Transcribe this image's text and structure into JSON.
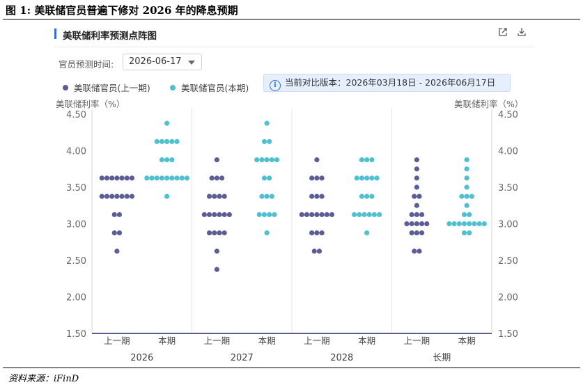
{
  "figure": {
    "title": "图 1:  美联储官员普遍下修对 2026 年的降息预期",
    "source": "资料来源：iFinD"
  },
  "panel": {
    "title": "美联储利率预测点阵图",
    "export_icon": "external-link-icon",
    "download_icon": "download-icon"
  },
  "controls": {
    "date_label": "官员预测时间:",
    "date_value": "2026-06-17"
  },
  "legend": {
    "previous": "美联储官员(上一期)",
    "current": "美联储官员(本期)",
    "compare_text": "当前对比版本：2026年03月18日 - 2026年06月17日"
  },
  "colors": {
    "previous": "#5b5e96",
    "current": "#4fc0cf",
    "axis": "#5b5e96"
  },
  "chart_data": {
    "type": "scatter",
    "subtype": "dot-plot",
    "ylabel": "美联储利率（%）",
    "ylabel_right": "美联储利率（%）",
    "ylim": [
      1.5,
      4.5
    ],
    "yticks": [
      "1.50",
      "2.00",
      "2.50",
      "3.00",
      "3.50",
      "4.00",
      "4.50"
    ],
    "groups": [
      "2026",
      "2027",
      "2028",
      "长期"
    ],
    "sub_labels": [
      "上一期",
      "本期"
    ],
    "grid": "vertical group separators",
    "data": [
      {
        "group": "2026",
        "previous": [
          {
            "y": 3.625,
            "n": 7
          },
          {
            "y": 3.375,
            "n": 7
          },
          {
            "y": 3.125,
            "n": 2
          },
          {
            "y": 2.875,
            "n": 2
          },
          {
            "y": 2.625,
            "n": 1
          }
        ],
        "current": [
          {
            "y": 4.375,
            "n": 1
          },
          {
            "y": 4.125,
            "n": 5
          },
          {
            "y": 3.875,
            "n": 3
          },
          {
            "y": 3.625,
            "n": 9
          },
          {
            "y": 3.375,
            "n": 1
          }
        ]
      },
      {
        "group": "2027",
        "previous": [
          {
            "y": 3.875,
            "n": 1
          },
          {
            "y": 3.625,
            "n": 3
          },
          {
            "y": 3.375,
            "n": 4
          },
          {
            "y": 3.125,
            "n": 6
          },
          {
            "y": 2.875,
            "n": 4
          },
          {
            "y": 2.625,
            "n": 1
          },
          {
            "y": 2.375,
            "n": 1
          }
        ],
        "current": [
          {
            "y": 4.375,
            "n": 1
          },
          {
            "y": 4.125,
            "n": 2
          },
          {
            "y": 3.875,
            "n": 5
          },
          {
            "y": 3.625,
            "n": 2
          },
          {
            "y": 3.375,
            "n": 3
          },
          {
            "y": 3.125,
            "n": 4
          },
          {
            "y": 2.875,
            "n": 1
          }
        ]
      },
      {
        "group": "2028",
        "previous": [
          {
            "y": 3.875,
            "n": 1
          },
          {
            "y": 3.625,
            "n": 3
          },
          {
            "y": 3.375,
            "n": 3
          },
          {
            "y": 3.125,
            "n": 7
          },
          {
            "y": 2.875,
            "n": 3
          },
          {
            "y": 2.625,
            "n": 2
          }
        ],
        "current": [
          {
            "y": 3.875,
            "n": 3
          },
          {
            "y": 3.625,
            "n": 5
          },
          {
            "y": 3.375,
            "n": 3
          },
          {
            "y": 3.125,
            "n": 6
          },
          {
            "y": 2.875,
            "n": 1
          }
        ]
      },
      {
        "group": "长期",
        "previous": [
          {
            "y": 3.875,
            "n": 1
          },
          {
            "y": 3.75,
            "n": 1
          },
          {
            "y": 3.625,
            "n": 1
          },
          {
            "y": 3.5,
            "n": 1
          },
          {
            "y": 3.375,
            "n": 2
          },
          {
            "y": 3.25,
            "n": 1
          },
          {
            "y": 3.125,
            "n": 3
          },
          {
            "y": 3.0,
            "n": 5
          },
          {
            "y": 2.875,
            "n": 3
          },
          {
            "y": 2.625,
            "n": 2
          }
        ],
        "current": [
          {
            "y": 3.875,
            "n": 1
          },
          {
            "y": 3.75,
            "n": 1
          },
          {
            "y": 3.625,
            "n": 1
          },
          {
            "y": 3.5,
            "n": 1
          },
          {
            "y": 3.375,
            "n": 3
          },
          {
            "y": 3.25,
            "n": 1
          },
          {
            "y": 3.125,
            "n": 2
          },
          {
            "y": 3.0,
            "n": 8
          },
          {
            "y": 2.875,
            "n": 2
          }
        ]
      }
    ]
  }
}
